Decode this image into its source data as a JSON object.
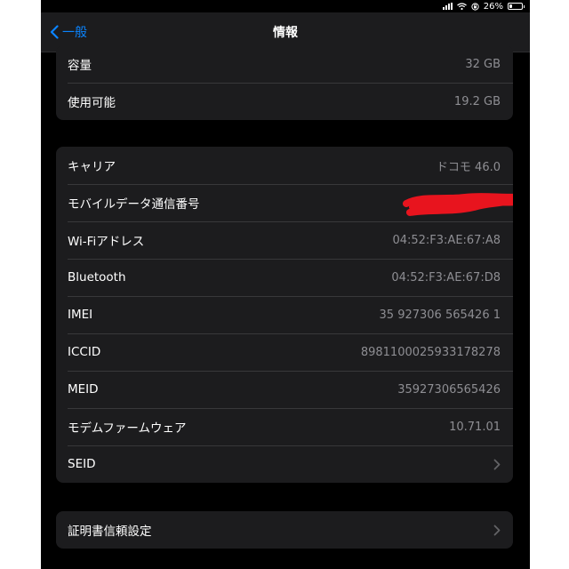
{
  "status_bar": {
    "battery": "26%",
    "battery_level": 0.26
  },
  "nav": {
    "back_label": "一般",
    "title": "情報"
  },
  "groups": {
    "storage": [
      {
        "label": "容量",
        "value": "32 GB"
      },
      {
        "label": "使用可能",
        "value": "19.2 GB"
      }
    ],
    "network": [
      {
        "label": "キャリア",
        "value": "ドコモ 46.0"
      },
      {
        "label": "モバイルデータ通信番号",
        "value": ""
      },
      {
        "label": "Wi-Fiアドレス",
        "value": "04:52:F3:AE:67:A8"
      },
      {
        "label": "Bluetooth",
        "value": "04:52:F3:AE:67:D8"
      },
      {
        "label": "IMEI",
        "value": "35 927306 565426 1"
      },
      {
        "label": "ICCID",
        "value": "8981100025933178278"
      },
      {
        "label": "MEID",
        "value": "35927306565426"
      },
      {
        "label": "モデムファームウェア",
        "value": "10.71.01"
      },
      {
        "label": "SEID",
        "value": ""
      }
    ],
    "certificates": [
      {
        "label": "証明書信頼設定"
      }
    ]
  },
  "colors": {
    "background": "#000000",
    "cell": "#1c1c1e",
    "accent": "#0a84ff",
    "secondary_text": "#8e8e93",
    "redaction": "#e8141e"
  },
  "icons": {
    "back": "chevron-left-icon",
    "disclosure": "chevron-right-icon",
    "signal": "cellular-signal-icon",
    "wifi": "wifi-icon",
    "lock": "orientation-lock-icon",
    "battery": "battery-icon"
  }
}
